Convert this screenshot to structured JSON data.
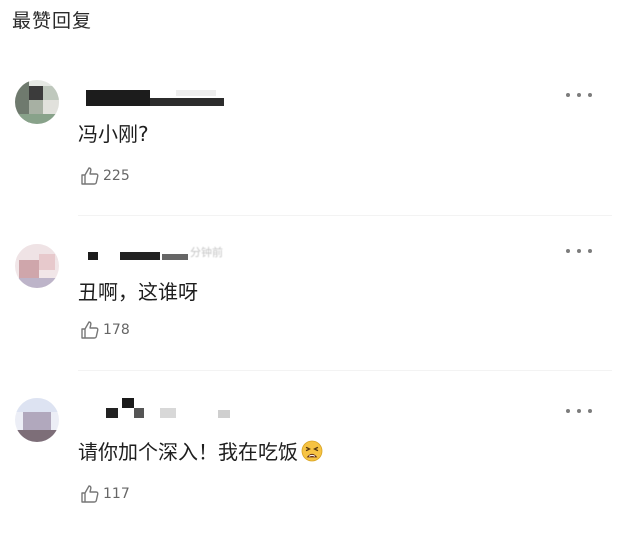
{
  "header": {
    "title": "最赞回复"
  },
  "icons": {
    "more": "more-dots-icon",
    "like": "thumbs-up-icon",
    "emoji": "tired-face-emoji"
  },
  "comments": [
    {
      "text": "冯小刚?",
      "likes": "225",
      "avatar_color": "#9aa79a"
    },
    {
      "text": "丑啊，这谁呀",
      "likes": "178",
      "meta": "分钟前",
      "avatar_color": "#d9b7ba"
    },
    {
      "text": "请你加个深入！我在吃饭",
      "likes": "117",
      "avatar_color": "#b4b9d2"
    }
  ]
}
